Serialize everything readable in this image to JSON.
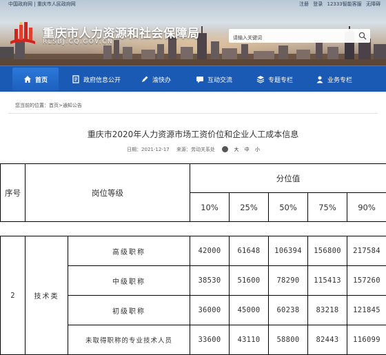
{
  "topbar": {
    "left": [
      "中国政府网",
      "重庆市人民政府网"
    ],
    "right": [
      "注册",
      "登录",
      "12333智能客服",
      "无障碍"
    ]
  },
  "header": {
    "title": "重庆市人力资源和社会保障局",
    "domain": "RLSBJ.CQ.GOV.CN",
    "search_placeholder": "请输入关键词"
  },
  "nav": {
    "items": [
      {
        "label": "首页",
        "icon": "home-icon"
      },
      {
        "label": "政府信息公开",
        "icon": "document-icon"
      },
      {
        "label": "渝快办",
        "icon": "pencil-icon"
      },
      {
        "label": "互动交流",
        "icon": "chat-icon"
      },
      {
        "label": "专题专栏",
        "icon": "layers-icon"
      },
      {
        "label": "业务专栏",
        "icon": "user-icon"
      }
    ]
  },
  "breadcrumb": {
    "text": "您当前的位置：首页>通知公告"
  },
  "article": {
    "title": "重庆市2020年人力资源市场工资价位和企业人工成本信息",
    "date": "日期：2021-12-17",
    "source": "来源：劳动关系处",
    "font_sizes": [
      "大",
      "中",
      "小"
    ]
  },
  "table": {
    "header": {
      "seq": "序号",
      "position": "岗位等级",
      "group": "分位值",
      "percentiles": [
        "10%",
        "25%",
        "50%",
        "75%",
        "90%"
      ]
    },
    "seq": "2",
    "category": "技术类",
    "rows": [
      {
        "rank": "高级职称",
        "values": [
          "42000",
          "61648",
          "106394",
          "156800",
          "217584"
        ]
      },
      {
        "rank": "中级职称",
        "values": [
          "38530",
          "51600",
          "78290",
          "115413",
          "157260"
        ]
      },
      {
        "rank": "初级职称",
        "values": [
          "36000",
          "45000",
          "60238",
          "83218",
          "121845"
        ]
      },
      {
        "rank": "未取得职称的专业技术人员",
        "values": [
          "33600",
          "43110",
          "58800",
          "82443",
          "116099"
        ]
      }
    ]
  },
  "colors": {
    "nav_bg": "#1a5ab4",
    "nav_active": "#2c78d8",
    "emblem_red": "#d3231c"
  }
}
